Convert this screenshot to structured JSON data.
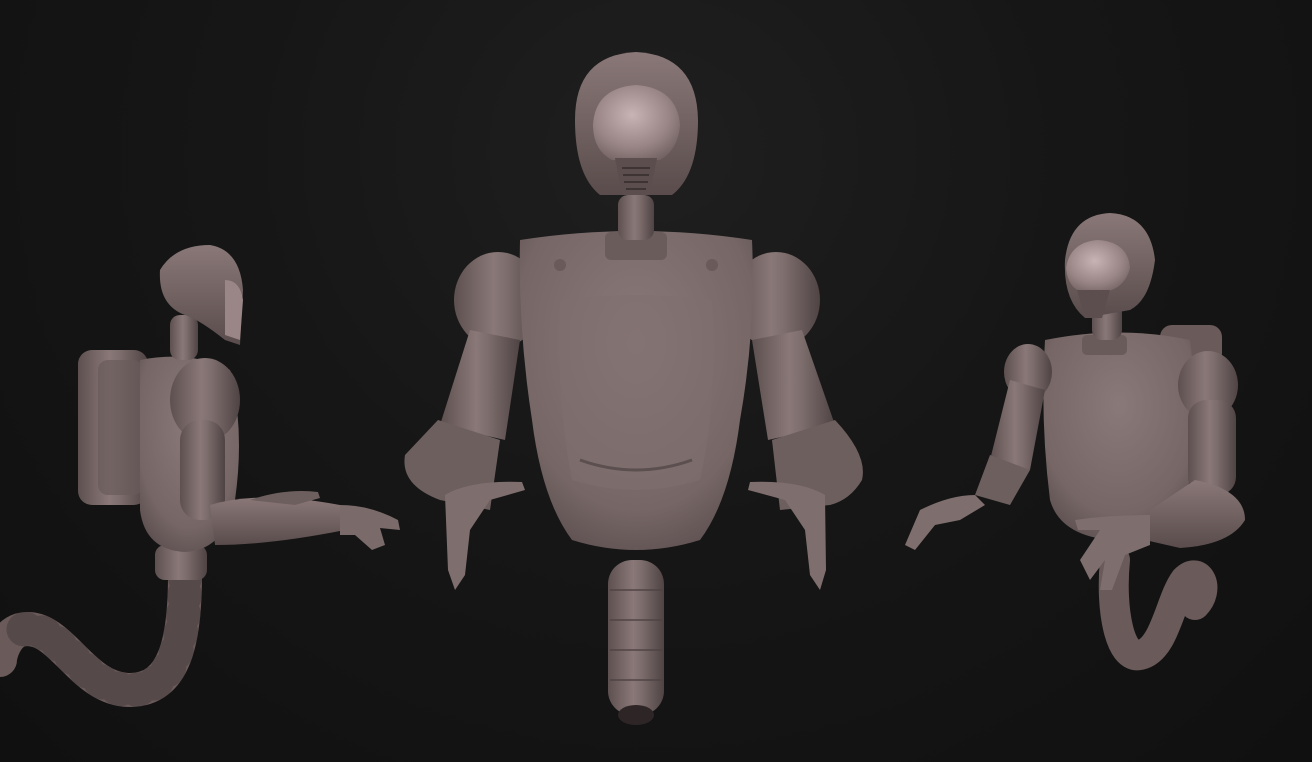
{
  "scene": {
    "background_color": "#141414",
    "material_color": "#7a6a6a",
    "views": [
      {
        "name": "left-side-view"
      },
      {
        "name": "front-view"
      },
      {
        "name": "three-quarter-view"
      }
    ]
  }
}
